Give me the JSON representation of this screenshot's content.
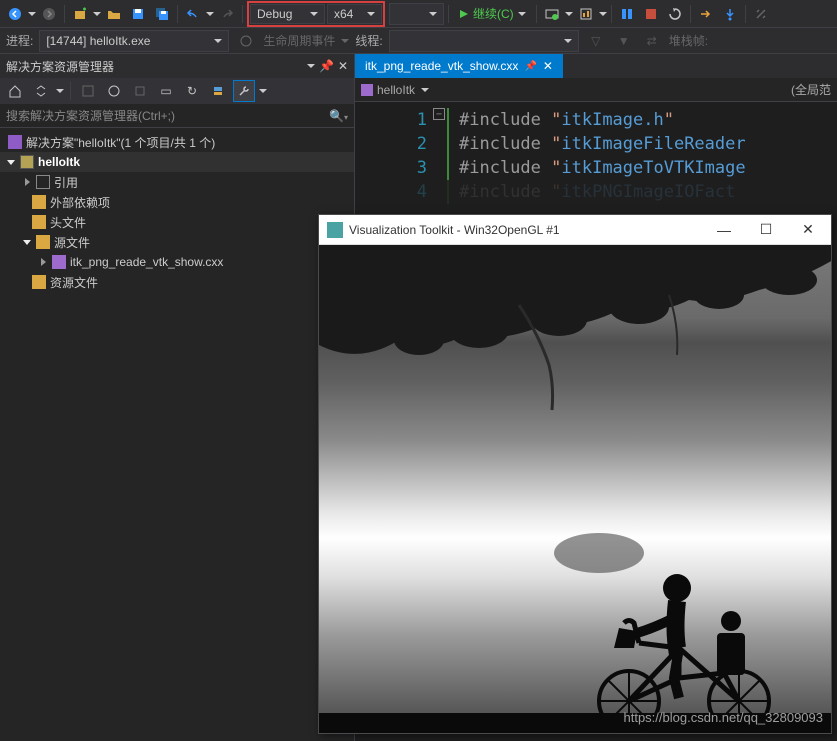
{
  "toolbar": {
    "config": "Debug",
    "platform": "x64",
    "continue_label": "继续(C)"
  },
  "debug_row": {
    "process_label": "进程:",
    "process_value": "[14744] helloItk.exe",
    "lifecycle_label": "生命周期事件",
    "thread_label": "线程:",
    "stackframe_label": "堆栈帧:"
  },
  "solution_panel": {
    "title": "解决方案资源管理器",
    "search_placeholder": "搜索解决方案资源管理器(Ctrl+;)",
    "solution_text": "解决方案\"helloItk\"(1 个项目/共 1 个)",
    "project": "helloItk",
    "references": "引用",
    "external_deps": "外部依赖项",
    "headers": "头文件",
    "sources": "源文件",
    "source_file": "itk_png_reade_vtk_show.cxx",
    "resources": "资源文件"
  },
  "editor": {
    "tab_name": "itk_png_reade_vtk_show.cxx",
    "context_scope": "helloItk",
    "context_right": "(全局范",
    "lines": {
      "1": "#include \"itkImage.h\"",
      "2": "#include \"itkImageFileReader",
      "3": "#include \"itkImageToVTKImage",
      "4": "#include \"itkPNGImageIOFact"
    }
  },
  "popup": {
    "title": "Visualization Toolkit - Win32OpenGL #1"
  },
  "watermark": "https://blog.csdn.net/qq_32809093"
}
